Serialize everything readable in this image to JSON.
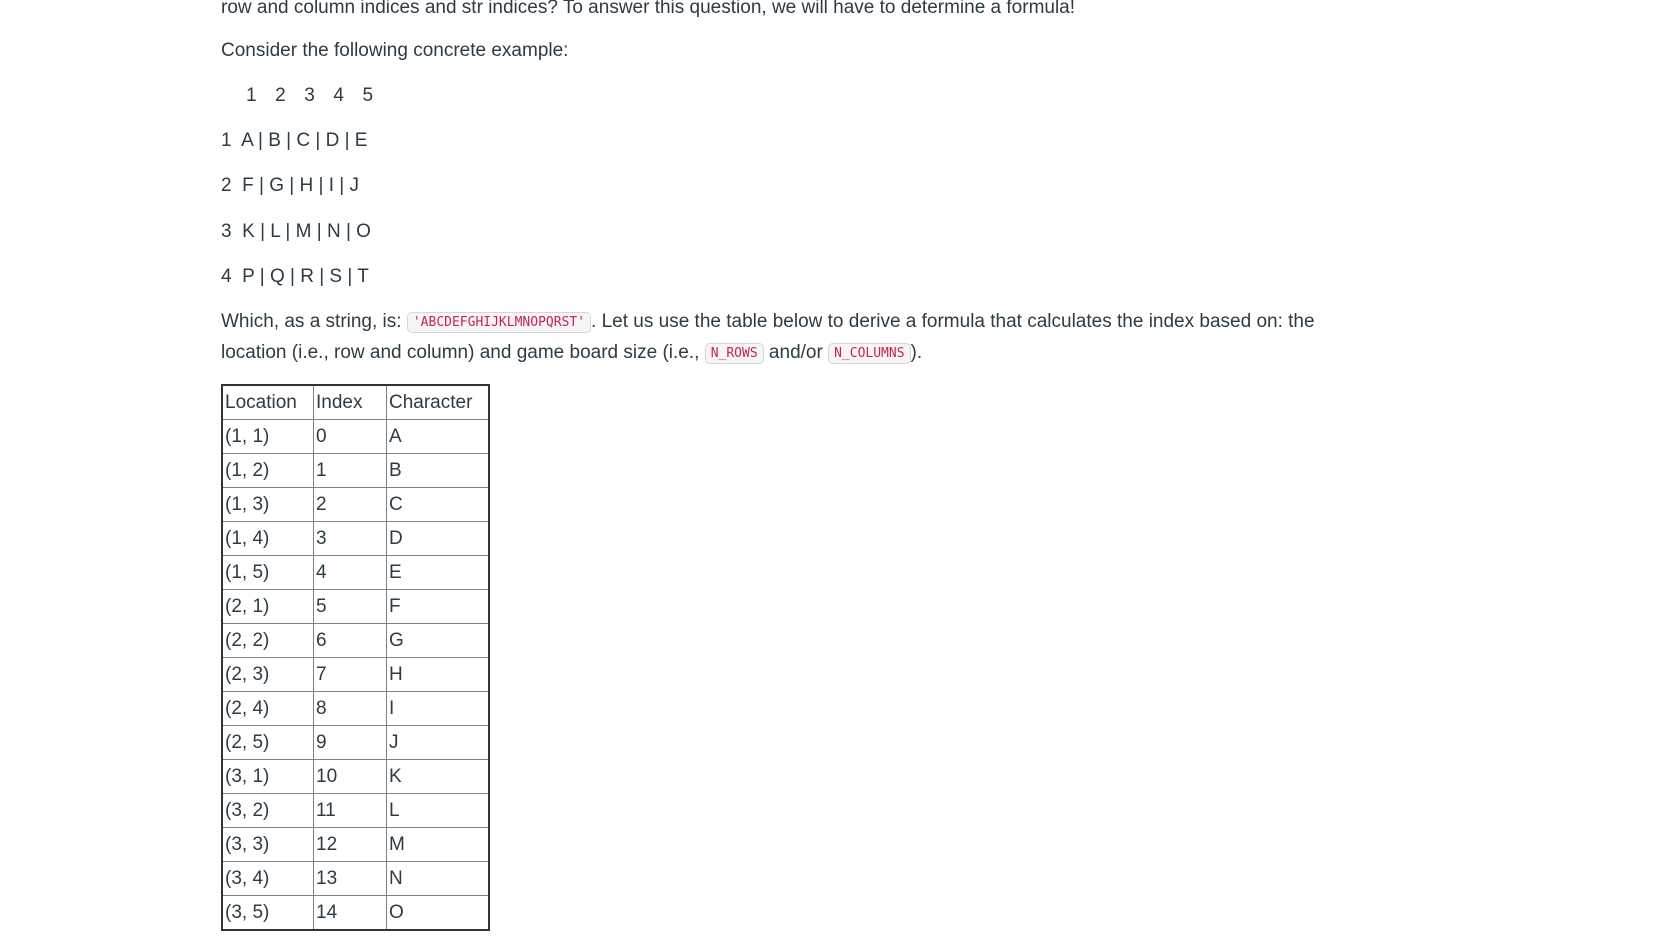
{
  "intro_line": "row and column indices and str indices? To answer this question, we will have to determine a formula!",
  "example_intro": "Consider the following concrete example:",
  "grid": {
    "column_header": "1  2  3  4  5",
    "rows": [
      "1  A | B | C | D | E",
      "2  F | G | H | I | J",
      "3  K | L | M | N | O",
      "4  P | Q | R | S | T"
    ]
  },
  "explanation": {
    "part1": "Which, as a string, is: ",
    "string_code": "'ABCDEFGHIJKLMNOPQRST'",
    "part2": ". Let us use the table below to derive a formula that calculates the index based on: the location (i.e., row and column) and game board size (i.e., ",
    "rows_code": "N_ROWS",
    "part3": " and/or ",
    "cols_code": "N_COLUMNS",
    "part4": ")."
  },
  "table": {
    "headers": [
      "Location",
      "Index",
      "Character"
    ],
    "rows": [
      [
        "(1, 1)",
        "0",
        "A"
      ],
      [
        "(1, 2)",
        "1",
        "B"
      ],
      [
        "(1, 3)",
        "2",
        "C"
      ],
      [
        "(1, 4)",
        "3",
        "D"
      ],
      [
        "(1, 5)",
        "4",
        "E"
      ],
      [
        "(2, 1)",
        "5",
        "F"
      ],
      [
        "(2, 2)",
        "6",
        "G"
      ],
      [
        "(2, 3)",
        "7",
        "H"
      ],
      [
        "(2, 4)",
        "8",
        "I"
      ],
      [
        "(2, 5)",
        "9",
        "J"
      ],
      [
        "(3, 1)",
        "10",
        "K"
      ],
      [
        "(3, 2)",
        "11",
        "L"
      ],
      [
        "(3, 3)",
        "12",
        "M"
      ],
      [
        "(3, 4)",
        "13",
        "N"
      ],
      [
        "(3, 5)",
        "14",
        "O"
      ]
    ]
  }
}
